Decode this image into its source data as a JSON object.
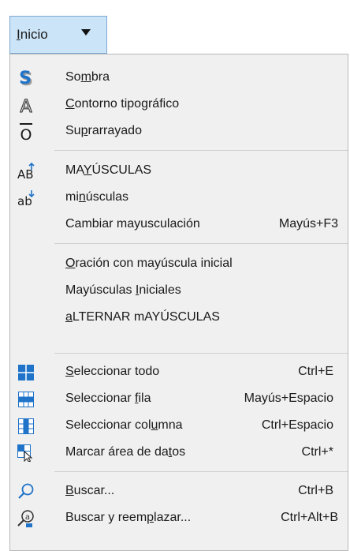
{
  "header": {
    "inicio_pre": "",
    "inicio_u": "I",
    "inicio_post": "nicio"
  },
  "icons": {
    "shadow": "shadow-s-icon",
    "outline": "outline-a-icon",
    "overline": "overline-o-icon",
    "uppercase": "uppercase-ab-icon",
    "lowercase": "lowercase-ab-icon",
    "select_all": "select-all-grid-icon",
    "select_row": "select-row-grid-icon",
    "select_column": "select-column-grid-icon",
    "data_area": "data-area-icon",
    "find": "find-magnifier-icon",
    "find_replace": "find-replace-icon"
  },
  "colors": {
    "accent_blue": "#1f73c9",
    "accent_light": "#cce4f7"
  },
  "menu": {
    "sombra": {
      "a": "So",
      "u": "m",
      "b": "bra",
      "shortcut": ""
    },
    "contorno": {
      "a": "",
      "u": "C",
      "b": "ontorno tipográfico",
      "shortcut": ""
    },
    "suprarrayado": {
      "a": "Su",
      "u": "p",
      "b": "rarrayado",
      "shortcut": ""
    },
    "mayusculas": {
      "a": "MA",
      "u": "Y",
      "b": "ÚSCULAS",
      "shortcut": ""
    },
    "minusculas": {
      "a": "mi",
      "u": "n",
      "b": "úsculas",
      "shortcut": ""
    },
    "cambiar": {
      "a": "Cambiar mayusculación",
      "u": "",
      "b": "",
      "shortcut": "Mayús+F3"
    },
    "oracion": {
      "a": "",
      "u": "O",
      "b": "ración con mayúscula inicial",
      "shortcut": ""
    },
    "iniciales": {
      "a": "Mayúsculas ",
      "u": "I",
      "b": "niciales",
      "shortcut": ""
    },
    "alternar": {
      "a": "",
      "u": "a",
      "b": "LTERNAR mAYÚSCULAS",
      "shortcut": ""
    },
    "sel_todo": {
      "a": "",
      "u": "S",
      "b": "eleccionar todo",
      "shortcut": "Ctrl+E"
    },
    "sel_fila": {
      "a": "Seleccionar ",
      "u": "f",
      "b": "ila",
      "shortcut": "Mayús+Espacio"
    },
    "sel_columna": {
      "a": "Seleccionar col",
      "u": "u",
      "b": "mna",
      "shortcut": "Ctrl+Espacio"
    },
    "marcar": {
      "a": "Marcar área de da",
      "u": "t",
      "b": "os",
      "shortcut": "Ctrl+*"
    },
    "buscar": {
      "a": "",
      "u": "B",
      "b": "uscar...",
      "shortcut": "Ctrl+B"
    },
    "reemplazar": {
      "a": "Buscar y reem",
      "u": "p",
      "b": "lazar...",
      "shortcut": "Ctrl+Alt+B"
    }
  }
}
